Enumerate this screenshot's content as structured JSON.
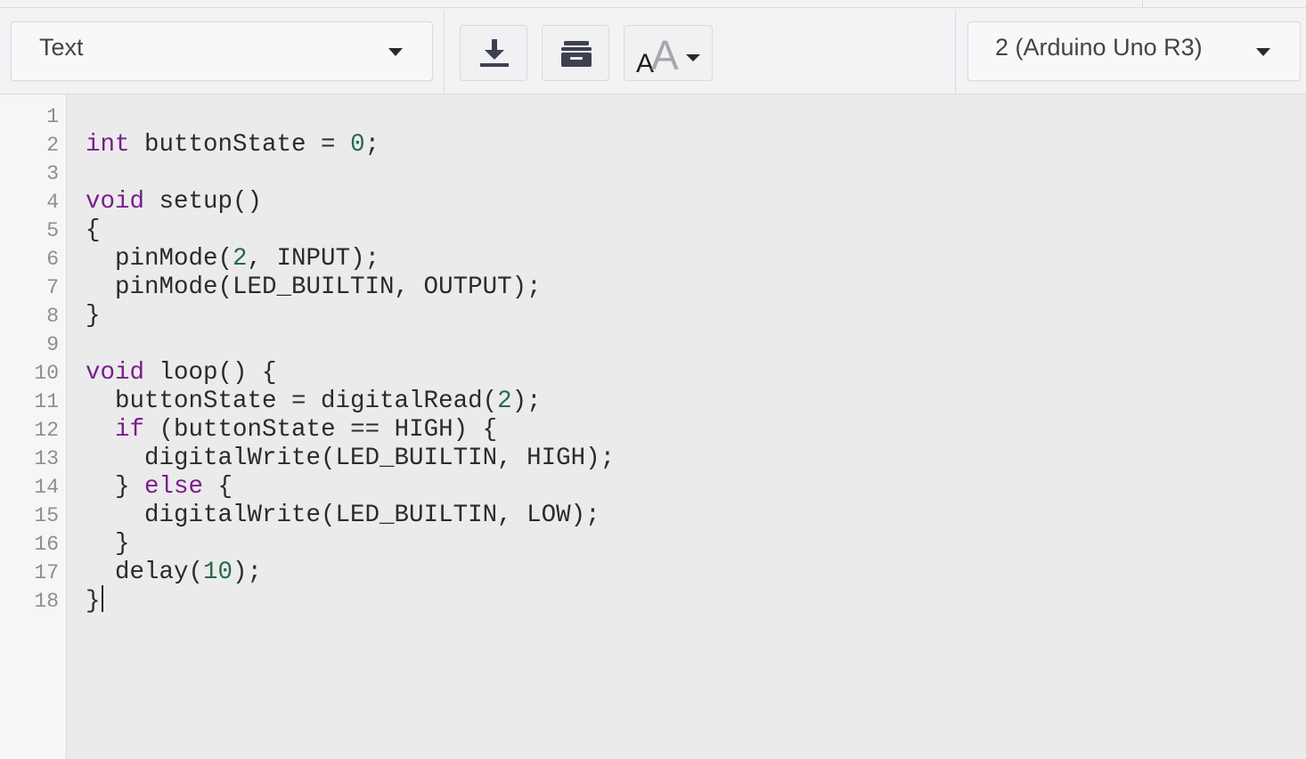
{
  "toolbar": {
    "mode_select": {
      "value": "Text"
    },
    "buttons": [
      {
        "name": "download",
        "icon": "download-icon"
      },
      {
        "name": "upload-library",
        "icon": "archive-box-icon"
      },
      {
        "name": "font-size",
        "icon": "font-size-icon"
      }
    ],
    "device_select": {
      "value": "2 (Arduino Uno R3)"
    }
  },
  "editor": {
    "lines": [
      {
        "no": "1",
        "tokens": []
      },
      {
        "no": "2",
        "tokens": [
          {
            "t": "int",
            "c": "kw"
          },
          {
            "t": " buttonState = "
          },
          {
            "t": "0",
            "c": "num"
          },
          {
            "t": ";"
          }
        ]
      },
      {
        "no": "3",
        "tokens": []
      },
      {
        "no": "4",
        "tokens": [
          {
            "t": "void",
            "c": "kw"
          },
          {
            "t": " setup()"
          }
        ]
      },
      {
        "no": "5",
        "tokens": [
          {
            "t": "{"
          }
        ]
      },
      {
        "no": "6",
        "tokens": [
          {
            "t": "  pinMode("
          },
          {
            "t": "2",
            "c": "num"
          },
          {
            "t": ", INPUT);"
          }
        ]
      },
      {
        "no": "7",
        "tokens": [
          {
            "t": "  pinMode(LED_BUILTIN, OUTPUT);"
          }
        ]
      },
      {
        "no": "8",
        "tokens": [
          {
            "t": "}"
          }
        ]
      },
      {
        "no": "9",
        "tokens": []
      },
      {
        "no": "10",
        "tokens": [
          {
            "t": "void",
            "c": "kw"
          },
          {
            "t": " loop() {"
          }
        ]
      },
      {
        "no": "11",
        "tokens": [
          {
            "t": "  buttonState = digitalRead("
          },
          {
            "t": "2",
            "c": "num"
          },
          {
            "t": ");"
          }
        ]
      },
      {
        "no": "12",
        "tokens": [
          {
            "t": "  "
          },
          {
            "t": "if",
            "c": "kw"
          },
          {
            "t": " (buttonState == HIGH) {"
          }
        ]
      },
      {
        "no": "13",
        "tokens": [
          {
            "t": "    digitalWrite(LED_BUILTIN, HIGH);"
          }
        ]
      },
      {
        "no": "14",
        "tokens": [
          {
            "t": "  } "
          },
          {
            "t": "else",
            "c": "kw"
          },
          {
            "t": " {"
          }
        ]
      },
      {
        "no": "15",
        "tokens": [
          {
            "t": "    digitalWrite(LED_BUILTIN, LOW);"
          }
        ]
      },
      {
        "no": "16",
        "tokens": [
          {
            "t": "  }"
          }
        ]
      },
      {
        "no": "17",
        "tokens": [
          {
            "t": "  delay("
          },
          {
            "t": "10",
            "c": "num"
          },
          {
            "t": ");"
          }
        ]
      },
      {
        "no": "18",
        "tokens": [
          {
            "t": "}"
          }
        ],
        "cursor": true
      }
    ],
    "colors": {
      "keyword": "#7a1d8e",
      "number": "#256b48",
      "text": "#2b2b2b",
      "line_number": "#8d8d93"
    }
  }
}
